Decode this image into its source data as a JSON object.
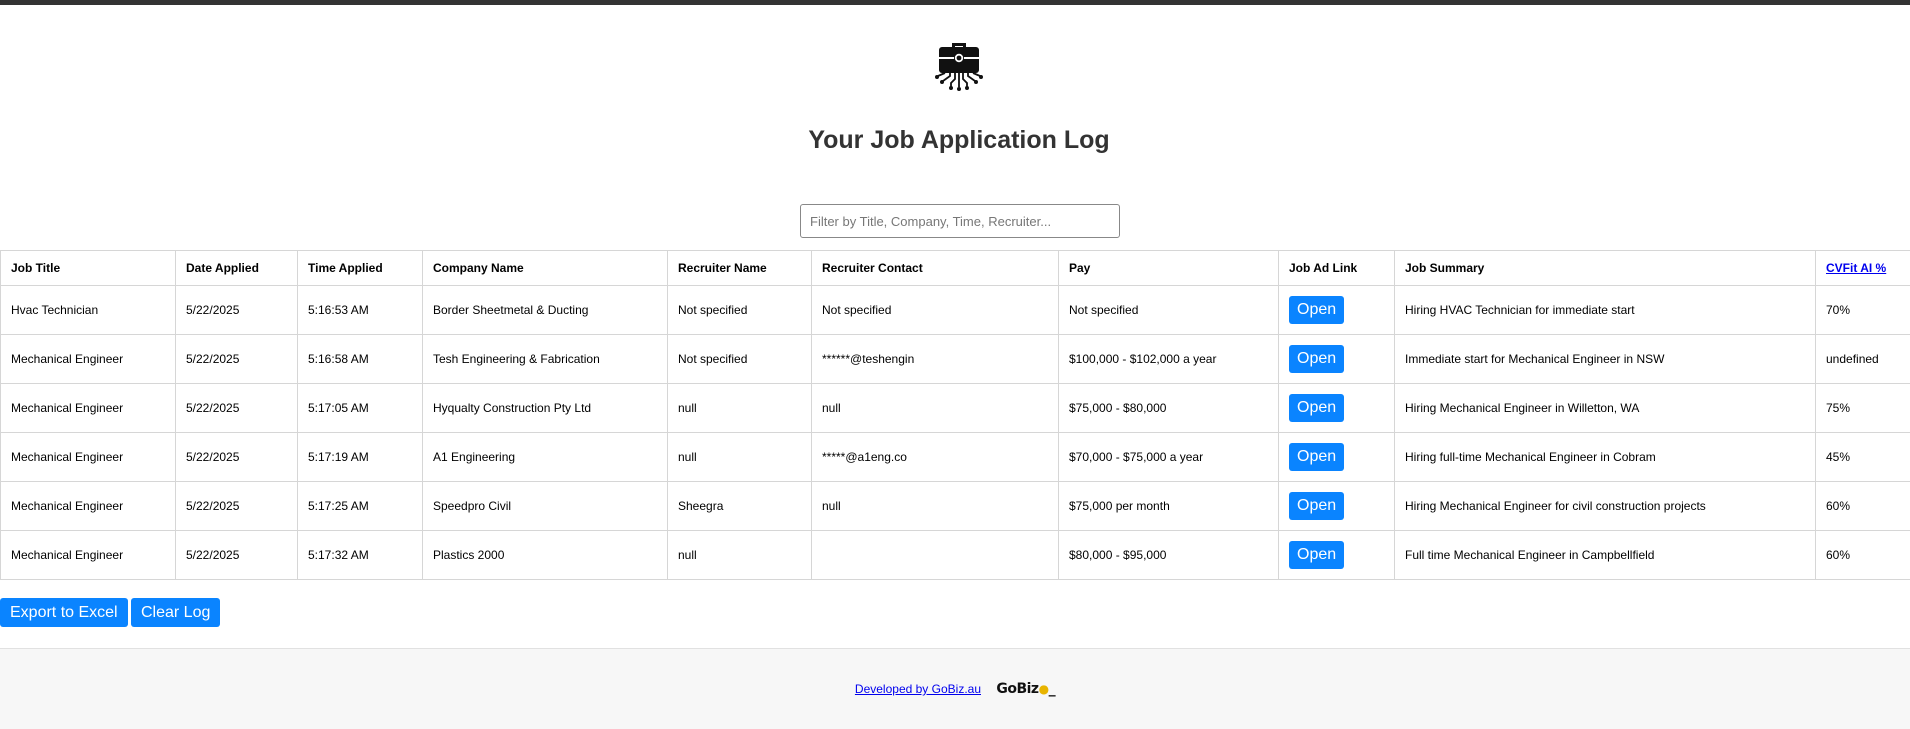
{
  "header": {
    "title": "Your Job Application Log",
    "logo_icon": "briefcase-circuit-icon"
  },
  "filter": {
    "placeholder": "Filter by Title, Company, Time, Recruiter..."
  },
  "table": {
    "columns": [
      "Job Title",
      "Date Applied",
      "Time Applied",
      "Company Name",
      "Recruiter Name",
      "Recruiter Contact",
      "Pay",
      "Job Ad Link",
      "Job Summary",
      "CVFit AI %"
    ],
    "open_label": "Open",
    "rows": [
      {
        "title": "Hvac Technician",
        "date": "5/22/2025",
        "time": "5:16:53 AM",
        "company": "Border Sheetmetal & Ducting",
        "recruiter": "Not specified",
        "contact": "Not specified",
        "pay": "Not specified",
        "summary": "Hiring HVAC Technician for immediate start",
        "fit": "70%"
      },
      {
        "title": "Mechanical Engineer",
        "date": "5/22/2025",
        "time": "5:16:58 AM",
        "company": "Tesh Engineering & Fabrication",
        "recruiter": "Not specified",
        "contact": "******@teshengin",
        "pay": "$100,000 - $102,000 a year",
        "summary": "Immediate start for Mechanical Engineer in NSW",
        "fit": "undefined"
      },
      {
        "title": "Mechanical Engineer",
        "date": "5/22/2025",
        "time": "5:17:05 AM",
        "company": "Hyqualty Construction Pty Ltd",
        "recruiter": "null",
        "contact": "null",
        "pay": "$75,000 - $80,000",
        "summary": "Hiring Mechanical Engineer in Willetton, WA",
        "fit": "75%"
      },
      {
        "title": "Mechanical Engineer",
        "date": "5/22/2025",
        "time": "5:17:19 AM",
        "company": "A1 Engineering",
        "recruiter": "null",
        "contact": "*****@a1eng.co",
        "pay": "$70,000 - $75,000 a year",
        "summary": "Hiring full-time Mechanical Engineer in Cobram",
        "fit": "45%"
      },
      {
        "title": "Mechanical Engineer",
        "date": "5/22/2025",
        "time": "5:17:25 AM",
        "company": "Speedpro Civil",
        "recruiter": "Sheegra",
        "contact": "null",
        "pay": "$75,000 per month",
        "summary": "Hiring Mechanical Engineer for civil construction projects",
        "fit": "60%"
      },
      {
        "title": "Mechanical Engineer",
        "date": "5/22/2025",
        "time": "5:17:32 AM",
        "company": "Plastics 2000",
        "recruiter": "null",
        "contact": "",
        "pay": "$80,000 - $95,000",
        "summary": "Full time Mechanical Engineer in Campbellfield",
        "fit": "60%"
      }
    ]
  },
  "actions": {
    "export_label": "Export to Excel",
    "clear_label": "Clear Log"
  },
  "footer": {
    "credit_link": "Developed by GoBiz.au",
    "brand_text": "GoBiz",
    "brand_dot": "●",
    "brand_suffix": "_"
  },
  "colors": {
    "button": "#0a84ff",
    "topbar": "#333333",
    "title": "#333333"
  }
}
